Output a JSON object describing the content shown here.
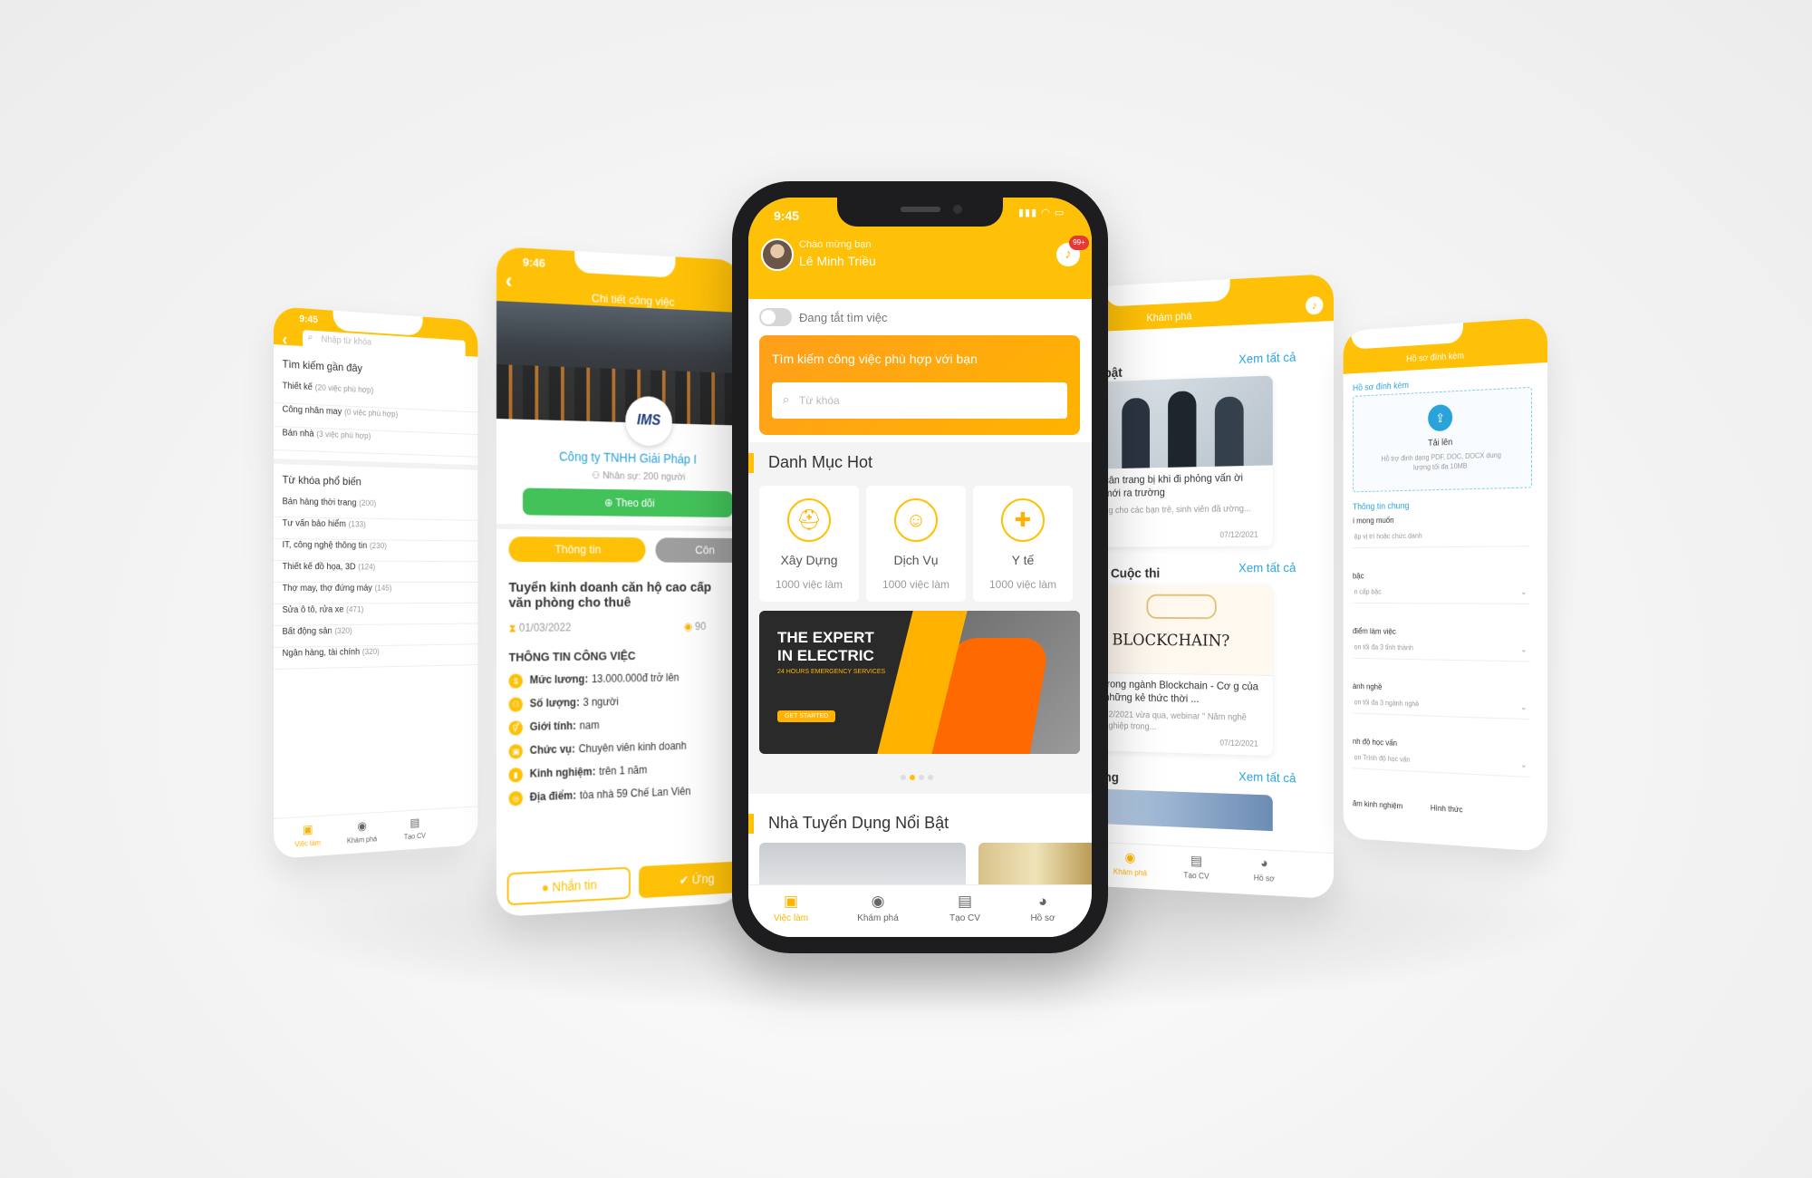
{
  "screen_search": {
    "time": "9:45",
    "search_placeholder": "Nhập từ khóa",
    "recent_title": "Tìm kiếm gần đây",
    "recent": [
      {
        "label": "Thiết kế",
        "count": "(20 việc phù hợp)"
      },
      {
        "label": "Công nhân may",
        "count": "(0 việc phù hợp)"
      },
      {
        "label": "Bán nhà",
        "count": "(3 việc phù hợp)"
      }
    ],
    "popular_title": "Từ khóa phổ biến",
    "popular": [
      {
        "label": "Bán hàng thời trang",
        "count": "(200)"
      },
      {
        "label": "Tư vấn bảo hiểm",
        "count": "(133)"
      },
      {
        "label": "IT, công nghệ thông tin",
        "count": "(230)"
      },
      {
        "label": "Thiết kế đồ họa, 3D",
        "count": "(124)"
      },
      {
        "label": "Thợ may, thợ đứng máy",
        "count": "(145)"
      },
      {
        "label": "Sửa ô tô, rửa xe",
        "count": "(471)"
      },
      {
        "label": "Bất động sản",
        "count": "(320)"
      },
      {
        "label": "Ngân hàng, tài chính",
        "count": "(320)"
      }
    ],
    "tabs": [
      "Việc làm",
      "Khám phá",
      "Tạo CV"
    ]
  },
  "screen_detail": {
    "time": "9:46",
    "title": "Chi tiết công việc",
    "logo_text": "IMS",
    "company": "Công ty TNHH Giải Pháp I",
    "staff": "Nhân sự: 200 người",
    "follow": "Theo dõi",
    "tab_info": "Thông tin",
    "tab_company": "Côn",
    "job_title": "Tuyển kinh doanh căn hộ cao cấp văn phòng cho thuê",
    "date": "01/03/2022",
    "views": "90",
    "section": "THÔNG TIN CÔNG VIỆC",
    "fields": [
      {
        "label": "Mức lương:",
        "value": "13.000.000đ trở lên"
      },
      {
        "label": "Số lượng:",
        "value": "3 người"
      },
      {
        "label": "Giới tính:",
        "value": "nam"
      },
      {
        "label": "Chức vụ:",
        "value": "Chuyên viên kinh doanh"
      },
      {
        "label": "Kinh nghiệm:",
        "value": "trên 1 năm"
      },
      {
        "label": "Địa điểm:",
        "value": "tòa nhà 59 Chế Lan Viên"
      }
    ],
    "btn_message": "Nhắn tin",
    "btn_apply": "Ứng"
  },
  "screen_main": {
    "time": "9:45",
    "greeting": "Chào mừng bạn",
    "user": "Lê Minh Triều",
    "badge": "99+",
    "toggle_label": "Đang tắt tìm việc",
    "search_title": "Tìm kiếm công việc phù hợp với bạn",
    "search_placeholder": "Từ khóa",
    "hot_title": "Danh Mục Hot",
    "categories": [
      {
        "name": "Xây Dựng",
        "count": "1000 việc làm"
      },
      {
        "name": "Dịch Vụ",
        "count": "1000 việc làm"
      },
      {
        "name": "Y tế",
        "count": "1000 việc làm"
      }
    ],
    "banner_line1": "THE EXPERT",
    "banner_line2": "IN ELECTRIC",
    "banner_sub": "24 HOURS EMERGENCY SERVICES",
    "banner_btn": "GET STARTED",
    "employers_title": "Nhà Tuyển Dụng Nổi Bật",
    "tabs": [
      "Việc làm",
      "Khám phá",
      "Tạo CV",
      "Hồ sơ"
    ],
    "accent": "#FFC107"
  },
  "screen_explore": {
    "title": "Khám phá",
    "see_all": "Xem tất cả",
    "section1": "bật",
    "article1_title": "cân trang bị khi đi phỏng vấn ời mới ra trường",
    "article1_desc": "ng cho các bạn trẻ, sinh viên đã ường...",
    "article1_date": "07/12/2021",
    "section2": "/ Cuộc thi",
    "article2_image_text": "BLOCKCHAIN?",
    "article2_title": "trong ngành Blockchain - Cơ g của những kẻ thức thời ...",
    "article2_desc": "12/2021 vừa qua, webinar \" Năm nghề nghiệp trong...",
    "article2_date": "07/12/2021",
    "section3": "ng",
    "tabs": [
      "Khám phá",
      "Tạo CV",
      "Hồ sơ"
    ]
  },
  "screen_profile": {
    "title": "Hồ sơ đính kèm",
    "attach_label": "Hồ sơ đính kèm",
    "upload": "Tải lên",
    "upload_hint": "Hỗ trợ định dạng PDF, DOC, DOCX dung lượng tối đa 10MB",
    "general": "Thông tin chung",
    "fields": [
      {
        "label": "í mong muốn",
        "placeholder": "ập vị trí hoặc chức danh"
      },
      {
        "label": "bậc",
        "placeholder": "n cấp bậc"
      },
      {
        "label": "điểm làm việc",
        "placeholder": "ọn tối đa 3 tỉnh thành"
      },
      {
        "label": "ành nghề",
        "placeholder": "ọn tối đa 3 ngành nghề"
      },
      {
        "label": "nh độ học vấn",
        "placeholder": "ọn Trình độ học vấn"
      }
    ],
    "exp": "ăm kinh nghiệm",
    "form": "Hình thức"
  }
}
